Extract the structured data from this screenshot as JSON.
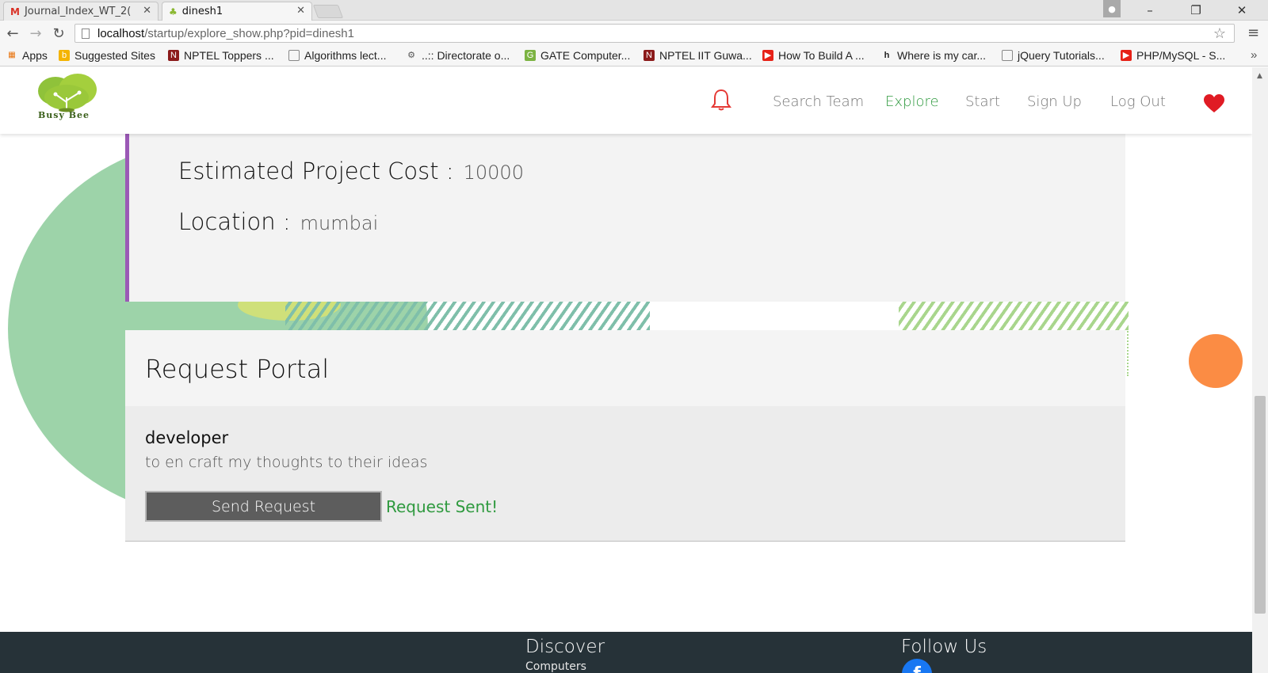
{
  "browser": {
    "tabs": [
      {
        "title": "Journal_Index_WT_2(",
        "icon": "gmail-icon",
        "active": false
      },
      {
        "title": "dinesh1",
        "icon": "tree-icon",
        "active": true
      }
    ],
    "url_host": "localhost",
    "url_path": "/startup/explore_show.php?pid=dinesh1",
    "bookmarks": [
      "Apps",
      "Suggested Sites",
      "NPTEL Toppers ...",
      "Algorithms lect...",
      "..:: Directorate o...",
      "GATE Computer...",
      "NPTEL IIT Guwa...",
      "How To Build A ...",
      "Where is my car...",
      "jQuery Tutorials...",
      "PHP/MySQL - S..."
    ],
    "overflow": "»"
  },
  "site": {
    "logo_text": "Busy Bee",
    "nav": [
      "Search Team",
      "Explore",
      "Start",
      "Sign Up",
      "Log Out"
    ],
    "active_nav": "Explore",
    "accent_color": "#2f9a3f"
  },
  "project": {
    "cost_label": "Estimated Project Cost :",
    "cost_value": "10000",
    "location_label": "Location :",
    "location_value": "mumbai"
  },
  "portal": {
    "title": "Request Portal",
    "role": "developer",
    "description": "to en craft my thoughts to their ideas",
    "button": "Send Request",
    "status": "Request Sent!"
  },
  "footer": {
    "discover_title": "Discover",
    "discover_link": "Computers",
    "follow_title": "Follow Us",
    "social_icon": "facebook-icon"
  }
}
